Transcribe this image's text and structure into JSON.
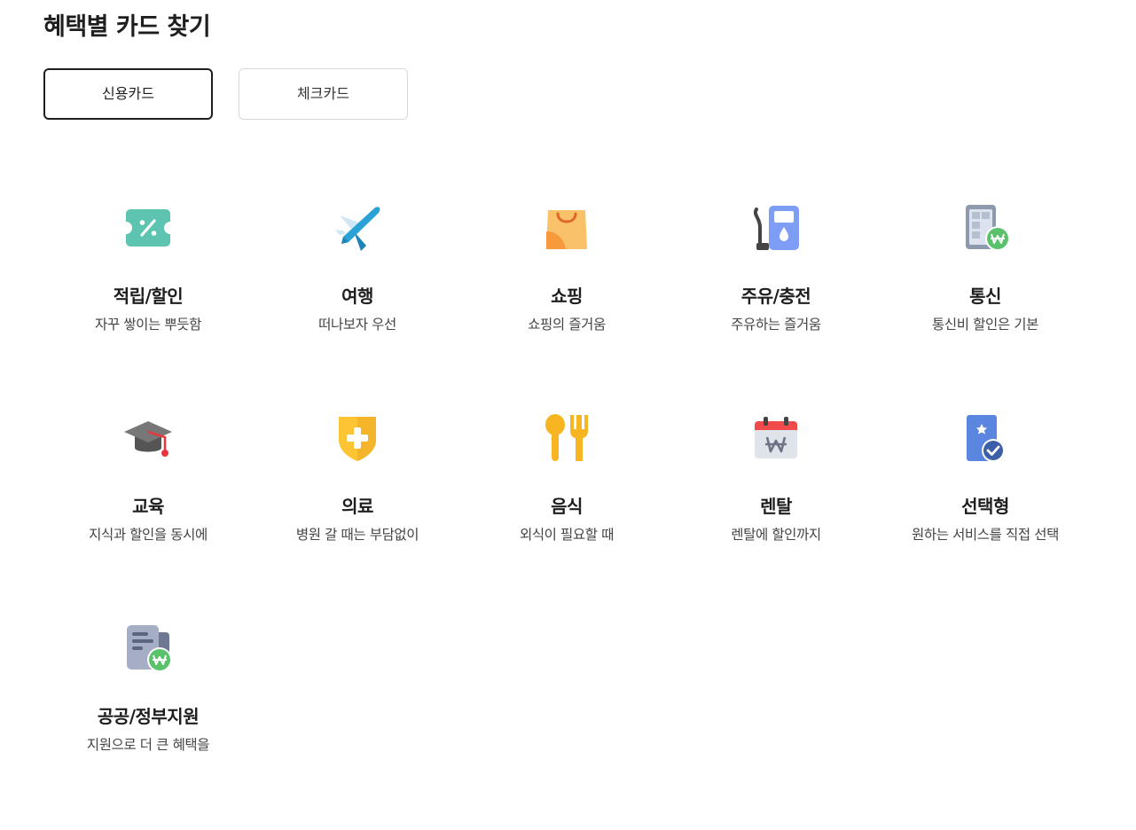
{
  "page": {
    "title": "혜택별 카드 찾기"
  },
  "tabs": [
    {
      "label": "신용카드",
      "active": true
    },
    {
      "label": "체크카드",
      "active": false
    }
  ],
  "categories": [
    {
      "name": "적립/할인",
      "desc": "자꾸 쌓이는 뿌듯함",
      "icon": "coupon-icon"
    },
    {
      "name": "여행",
      "desc": "떠나보자 우선",
      "icon": "airplane-icon"
    },
    {
      "name": "쇼핑",
      "desc": "쇼핑의 즐거움",
      "icon": "shopping-bag-icon"
    },
    {
      "name": "주유/충전",
      "desc": "주유하는 즐거움",
      "icon": "fuel-pump-icon"
    },
    {
      "name": "통신",
      "desc": "통신비 할인은 기본",
      "icon": "phone-won-icon"
    },
    {
      "name": "교육",
      "desc": "지식과 할인을 동시에",
      "icon": "graduation-cap-icon"
    },
    {
      "name": "의료",
      "desc": "병원 갈 때는 부담없이",
      "icon": "medical-shield-icon"
    },
    {
      "name": "음식",
      "desc": "외식이 필요할 때",
      "icon": "spoon-fork-icon"
    },
    {
      "name": "렌탈",
      "desc": "렌탈에 할인까지",
      "icon": "calendar-won-icon"
    },
    {
      "name": "선택형",
      "desc": "원하는 서비스를 직접 선택",
      "icon": "card-check-icon"
    },
    {
      "name": "공공/정부지원",
      "desc": "지원으로 더 큰 혜택을",
      "icon": "document-won-icon"
    }
  ],
  "colors": {
    "coupon": "#5cc4b0",
    "airplane": "#2196c9",
    "shopping": "#f8bf5e",
    "fuel": "#7e9ef5",
    "won_badge": "#59c26a",
    "graduation": "#666666",
    "tassel": "#e8363f",
    "medical": "#fdc533",
    "food": "#f7b521",
    "calendar_top": "#f04a4a",
    "card_blue": "#5b86e0",
    "document": "#a6aec5"
  }
}
